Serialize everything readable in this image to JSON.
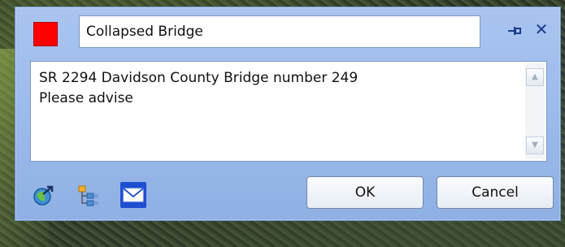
{
  "dialog": {
    "title_value": "Collapsed Bridge",
    "color": "#ff0000",
    "message_lines": [
      "SR 2294 Davidson County Bridge number 249",
      "Please advise"
    ],
    "ok_label": "OK",
    "cancel_label": "Cancel",
    "close_glyph": "✕",
    "icons": [
      "navigate-to-location-icon",
      "hierarchy-tree-icon",
      "email-icon"
    ]
  },
  "scrollbar": {
    "up_glyph": "▲",
    "down_glyph": "▼"
  }
}
